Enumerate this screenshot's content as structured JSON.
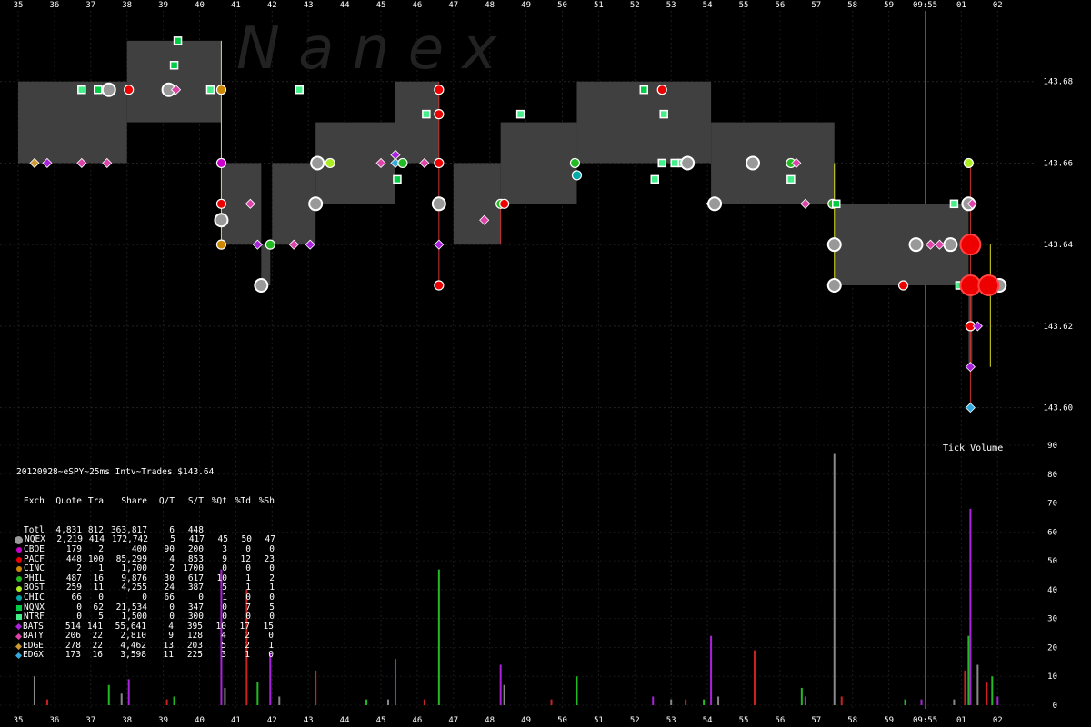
{
  "watermark": "N a n e x",
  "header": "20120928~eSPY~25ms Intv~Trades $143.64",
  "volume_title": "Tick Volume",
  "stats": {
    "columns": [
      "Exch",
      "Quote",
      "Tra",
      "Share",
      "Q/T",
      "S/T",
      "%Qt",
      "%Td",
      "%Sh"
    ],
    "rows": [
      {
        "exch": "Totl",
        "sym": "none",
        "color": "#000000",
        "vals": [
          "4,831",
          "812",
          "363,817",
          "6",
          "448",
          "",
          "",
          ""
        ]
      },
      {
        "exch": "NQEX",
        "sym": "big",
        "color": "#999999",
        "vals": [
          "2,219",
          "414",
          "172,742",
          "5",
          "417",
          "45",
          "50",
          "47"
        ]
      },
      {
        "exch": "CBOE",
        "sym": "dot",
        "color": "#cc00cc",
        "vals": [
          "179",
          "2",
          "400",
          "90",
          "200",
          "3",
          "0",
          "0"
        ]
      },
      {
        "exch": "PACF",
        "sym": "dot",
        "color": "#ee0000",
        "vals": [
          "448",
          "100",
          "85,299",
          "4",
          "853",
          "9",
          "12",
          "23"
        ]
      },
      {
        "exch": "CINC",
        "sym": "dot",
        "color": "#cc8800",
        "vals": [
          "2",
          "1",
          "1,700",
          "2",
          "1700",
          "0",
          "0",
          "0"
        ]
      },
      {
        "exch": "PHIL",
        "sym": "dot",
        "color": "#22bb22",
        "vals": [
          "487",
          "16",
          "9,876",
          "30",
          "617",
          "10",
          "1",
          "2"
        ]
      },
      {
        "exch": "BOST",
        "sym": "dot",
        "color": "#aaee22",
        "vals": [
          "259",
          "11",
          "4,255",
          "24",
          "387",
          "5",
          "1",
          "1"
        ]
      },
      {
        "exch": "CHIC",
        "sym": "dot",
        "color": "#00aaaa",
        "vals": [
          "66",
          "0",
          "0",
          "66",
          "0",
          "1",
          "0",
          "0"
        ]
      },
      {
        "exch": "NQNX",
        "sym": "sq",
        "color": "#00cc44",
        "vals": [
          "0",
          "62",
          "21,534",
          "0",
          "347",
          "0",
          "7",
          "5"
        ]
      },
      {
        "exch": "NTRF",
        "sym": "sq",
        "color": "#44ee88",
        "vals": [
          "0",
          "5",
          "1,500",
          "0",
          "300",
          "0",
          "0",
          "0"
        ]
      },
      {
        "exch": "BATS",
        "sym": "dia",
        "color": "#aa22dd",
        "vals": [
          "514",
          "141",
          "55,641",
          "4",
          "395",
          "10",
          "17",
          "15"
        ]
      },
      {
        "exch": "BATY",
        "sym": "dia",
        "color": "#dd44aa",
        "vals": [
          "206",
          "22",
          "2,810",
          "9",
          "128",
          "4",
          "2",
          "0"
        ]
      },
      {
        "exch": "EDGE",
        "sym": "dia",
        "color": "#cc9933",
        "vals": [
          "278",
          "22",
          "4,462",
          "13",
          "203",
          "5",
          "2",
          "1"
        ]
      },
      {
        "exch": "EDGX",
        "sym": "dia",
        "color": "#33aadd",
        "vals": [
          "173",
          "16",
          "3,598",
          "11",
          "225",
          "3",
          "1",
          "0"
        ]
      }
    ]
  },
  "chart_data": {
    "type": "scatter",
    "title": "20120928~eSPY~25ms Intv~Trades $143.64",
    "x_ticks": [
      "35",
      "36",
      "37",
      "38",
      "39",
      "40",
      "41",
      "42",
      "43",
      "44",
      "45",
      "46",
      "47",
      "48",
      "49",
      "50",
      "51",
      "52",
      "53",
      "54",
      "55",
      "56",
      "57",
      "58",
      "59",
      "09:55",
      "01",
      "02"
    ],
    "y_ticks": [
      143.68,
      143.66,
      143.64,
      143.62,
      143.6
    ],
    "ylim": [
      143.593,
      143.7
    ],
    "quote_boxes": [
      {
        "x0": 0,
        "x1": 3,
        "lo": 143.66,
        "hi": 143.68
      },
      {
        "x0": 3,
        "x1": 5.6,
        "lo": 143.67,
        "hi": 143.69
      },
      {
        "x0": 5.6,
        "x1": 6.7,
        "lo": 143.64,
        "hi": 143.66
      },
      {
        "x0": 6.7,
        "x1": 6.95,
        "lo": 143.63,
        "hi": 143.64
      },
      {
        "x0": 7,
        "x1": 8.2,
        "lo": 143.64,
        "hi": 143.66
      },
      {
        "x0": 8.2,
        "x1": 10.4,
        "lo": 143.65,
        "hi": 143.67
      },
      {
        "x0": 10.4,
        "x1": 11.6,
        "lo": 143.66,
        "hi": 143.68
      },
      {
        "x0": 12,
        "x1": 13.3,
        "lo": 143.64,
        "hi": 143.66
      },
      {
        "x0": 13.3,
        "x1": 15.4,
        "lo": 143.65,
        "hi": 143.67
      },
      {
        "x0": 15.4,
        "x1": 19.1,
        "lo": 143.66,
        "hi": 143.68
      },
      {
        "x0": 19.1,
        "x1": 22.5,
        "lo": 143.65,
        "hi": 143.67
      },
      {
        "x0": 22.5,
        "x1": 26.2,
        "lo": 143.63,
        "hi": 143.65
      },
      {
        "x0": 26.2,
        "x1": 26.3,
        "lo": 143.61,
        "hi": 143.63
      }
    ],
    "trades": [
      {
        "x": 0.45,
        "y": 143.66,
        "ex": "EDGE"
      },
      {
        "x": 0.8,
        "y": 143.66,
        "ex": "BATS"
      },
      {
        "x": 1.75,
        "y": 143.66,
        "ex": "BATY"
      },
      {
        "x": 2.45,
        "y": 143.66,
        "ex": "BATY"
      },
      {
        "x": 1.75,
        "y": 143.678,
        "ex": "NTRF"
      },
      {
        "x": 2.2,
        "y": 143.678,
        "ex": "NQNX"
      },
      {
        "x": 2.5,
        "y": 143.678,
        "ex": "NQEX"
      },
      {
        "x": 3.05,
        "y": 143.678,
        "ex": "PACF"
      },
      {
        "x": 4.15,
        "y": 143.678,
        "ex": "NQEX"
      },
      {
        "x": 4.35,
        "y": 143.678,
        "ex": "BATY"
      },
      {
        "x": 4.3,
        "y": 143.684,
        "ex": "NQNX"
      },
      {
        "x": 4.4,
        "y": 143.69,
        "ex": "NQNX"
      },
      {
        "x": 5.3,
        "y": 143.678,
        "ex": "NTRF"
      },
      {
        "x": 5.6,
        "y": 143.678,
        "ex": "CINC"
      },
      {
        "x": 5.6,
        "y": 143.66,
        "ex": "CBOE"
      },
      {
        "x": 5.6,
        "y": 143.65,
        "ex": "PACF"
      },
      {
        "x": 5.6,
        "y": 143.646,
        "ex": "NQEX"
      },
      {
        "x": 5.6,
        "y": 143.64,
        "ex": "CINC"
      },
      {
        "x": 6.4,
        "y": 143.65,
        "ex": "BATY"
      },
      {
        "x": 6.6,
        "y": 143.64,
        "ex": "BATS"
      },
      {
        "x": 6.7,
        "y": 143.63,
        "ex": "NQEX"
      },
      {
        "x": 6.95,
        "y": 143.64,
        "ex": "PHIL"
      },
      {
        "x": 7.6,
        "y": 143.64,
        "ex": "BATY"
      },
      {
        "x": 8.05,
        "y": 143.64,
        "ex": "BATS"
      },
      {
        "x": 7.75,
        "y": 143.678,
        "ex": "NTRF"
      },
      {
        "x": 8.2,
        "y": 143.65,
        "ex": "NQEX"
      },
      {
        "x": 8.25,
        "y": 143.66,
        "ex": "NQEX"
      },
      {
        "x": 8.6,
        "y": 143.66,
        "ex": "BOST"
      },
      {
        "x": 10.0,
        "y": 143.66,
        "ex": "BATY"
      },
      {
        "x": 10.4,
        "y": 143.66,
        "ex": "EDGX"
      },
      {
        "x": 10.6,
        "y": 143.66,
        "ex": "PHIL"
      },
      {
        "x": 10.4,
        "y": 143.662,
        "ex": "BATS"
      },
      {
        "x": 10.45,
        "y": 143.656,
        "ex": "NQNX"
      },
      {
        "x": 11.2,
        "y": 143.66,
        "ex": "BATY"
      },
      {
        "x": 11.6,
        "y": 143.66,
        "ex": "PACF"
      },
      {
        "x": 11.6,
        "y": 143.678,
        "ex": "PACF"
      },
      {
        "x": 11.6,
        "y": 143.672,
        "ex": "PACF"
      },
      {
        "x": 11.25,
        "y": 143.672,
        "ex": "NTRF"
      },
      {
        "x": 11.6,
        "y": 143.65,
        "ex": "NQEX"
      },
      {
        "x": 11.6,
        "y": 143.64,
        "ex": "BATS"
      },
      {
        "x": 11.6,
        "y": 143.63,
        "ex": "PACF"
      },
      {
        "x": 12.85,
        "y": 143.646,
        "ex": "BATY"
      },
      {
        "x": 13.3,
        "y": 143.65,
        "ex": "PHIL"
      },
      {
        "x": 13.4,
        "y": 143.65,
        "ex": "PACF"
      },
      {
        "x": 13.85,
        "y": 143.672,
        "ex": "NTRF"
      },
      {
        "x": 15.35,
        "y": 143.66,
        "ex": "PHIL"
      },
      {
        "x": 15.4,
        "y": 143.657,
        "ex": "CHIC"
      },
      {
        "x": 17.25,
        "y": 143.678,
        "ex": "NQNX"
      },
      {
        "x": 17.75,
        "y": 143.678,
        "ex": "PACF"
      },
      {
        "x": 17.8,
        "y": 143.672,
        "ex": "NTRF"
      },
      {
        "x": 17.75,
        "y": 143.66,
        "ex": "NTRF"
      },
      {
        "x": 18.1,
        "y": 143.66,
        "ex": "NTRF"
      },
      {
        "x": 18.3,
        "y": 143.66,
        "ex": "NTRF"
      },
      {
        "x": 18.45,
        "y": 143.66,
        "ex": "NQEX"
      },
      {
        "x": 17.55,
        "y": 143.656,
        "ex": "NTRF"
      },
      {
        "x": 19.1,
        "y": 143.65,
        "ex": "BATS"
      },
      {
        "x": 19.2,
        "y": 143.65,
        "ex": "NQEX"
      },
      {
        "x": 20.25,
        "y": 143.66,
        "ex": "NQEX"
      },
      {
        "x": 21.3,
        "y": 143.66,
        "ex": "PHIL"
      },
      {
        "x": 21.45,
        "y": 143.66,
        "ex": "BATY"
      },
      {
        "x": 21.3,
        "y": 143.656,
        "ex": "NTRF"
      },
      {
        "x": 21.7,
        "y": 143.65,
        "ex": "BATY"
      },
      {
        "x": 22.45,
        "y": 143.65,
        "ex": "PHIL"
      },
      {
        "x": 22.55,
        "y": 143.65,
        "ex": "NQNX"
      },
      {
        "x": 22.5,
        "y": 143.64,
        "ex": "NQEX"
      },
      {
        "x": 22.5,
        "y": 143.63,
        "ex": "NQEX"
      },
      {
        "x": 24.4,
        "y": 143.63,
        "ex": "PACF"
      },
      {
        "x": 24.75,
        "y": 143.64,
        "ex": "NQEX"
      },
      {
        "x": 25.15,
        "y": 143.64,
        "ex": "BATY"
      },
      {
        "x": 25.4,
        "y": 143.64,
        "ex": "BATY"
      },
      {
        "x": 25.7,
        "y": 143.64,
        "ex": "NQEX"
      },
      {
        "x": 25.8,
        "y": 143.65,
        "ex": "NTRF"
      },
      {
        "x": 25.95,
        "y": 143.63,
        "ex": "NTRF"
      },
      {
        "x": 26.2,
        "y": 143.66,
        "ex": "BOST"
      },
      {
        "x": 26.2,
        "y": 143.65,
        "ex": "NQEX"
      },
      {
        "x": 26.3,
        "y": 143.65,
        "ex": "BATY"
      },
      {
        "x": 26.25,
        "y": 143.64,
        "ex": "PACF"
      },
      {
        "x": 26.25,
        "y": 143.63,
        "ex": "PACF"
      },
      {
        "x": 26.25,
        "y": 143.62,
        "ex": "PACF"
      },
      {
        "x": 26.25,
        "y": 143.61,
        "ex": "BATS"
      },
      {
        "x": 26.25,
        "y": 143.6,
        "ex": "EDGX"
      },
      {
        "x": 26.45,
        "y": 143.62,
        "ex": "BATS"
      },
      {
        "x": 26.75,
        "y": 143.63,
        "ex": "PACF"
      },
      {
        "x": 27.05,
        "y": 143.63,
        "ex": "NQEX"
      }
    ],
    "volume": {
      "ylim": [
        0,
        90
      ],
      "y_ticks": [
        0,
        10,
        20,
        30,
        40,
        50,
        60,
        70,
        80,
        90
      ],
      "bars": [
        {
          "x": 0.45,
          "v": 10
        },
        {
          "x": 0.8,
          "v": 2
        },
        {
          "x": 2.5,
          "v": 7
        },
        {
          "x": 3.05,
          "v": 9
        },
        {
          "x": 2.85,
          "v": 4
        },
        {
          "x": 4.1,
          "v": 2
        },
        {
          "x": 4.3,
          "v": 3
        },
        {
          "x": 5.6,
          "v": 47
        },
        {
          "x": 5.7,
          "v": 6
        },
        {
          "x": 6.3,
          "v": 40
        },
        {
          "x": 6.6,
          "v": 8
        },
        {
          "x": 6.95,
          "v": 18
        },
        {
          "x": 7.2,
          "v": 3
        },
        {
          "x": 8.2,
          "v": 12
        },
        {
          "x": 9.6,
          "v": 2
        },
        {
          "x": 10.4,
          "v": 16
        },
        {
          "x": 10.2,
          "v": 2
        },
        {
          "x": 11.2,
          "v": 2
        },
        {
          "x": 11.6,
          "v": 47
        },
        {
          "x": 13.3,
          "v": 14
        },
        {
          "x": 13.4,
          "v": 7
        },
        {
          "x": 14.7,
          "v": 2
        },
        {
          "x": 15.4,
          "v": 10
        },
        {
          "x": 17.5,
          "v": 3
        },
        {
          "x": 18.0,
          "v": 2
        },
        {
          "x": 18.4,
          "v": 2
        },
        {
          "x": 18.9,
          "v": 2
        },
        {
          "x": 19.1,
          "v": 24
        },
        {
          "x": 19.3,
          "v": 3
        },
        {
          "x": 20.3,
          "v": 19
        },
        {
          "x": 21.6,
          "v": 6
        },
        {
          "x": 21.7,
          "v": 3
        },
        {
          "x": 22.5,
          "v": 87
        },
        {
          "x": 22.7,
          "v": 3
        },
        {
          "x": 24.45,
          "v": 2
        },
        {
          "x": 24.9,
          "v": 2
        },
        {
          "x": 25.8,
          "v": 2
        },
        {
          "x": 26.1,
          "v": 12
        },
        {
          "x": 26.2,
          "v": 24
        },
        {
          "x": 26.25,
          "v": 68
        },
        {
          "x": 26.45,
          "v": 14
        },
        {
          "x": 26.7,
          "v": 8
        },
        {
          "x": 26.85,
          "v": 10
        },
        {
          "x": 27.0,
          "v": 3
        }
      ]
    }
  }
}
